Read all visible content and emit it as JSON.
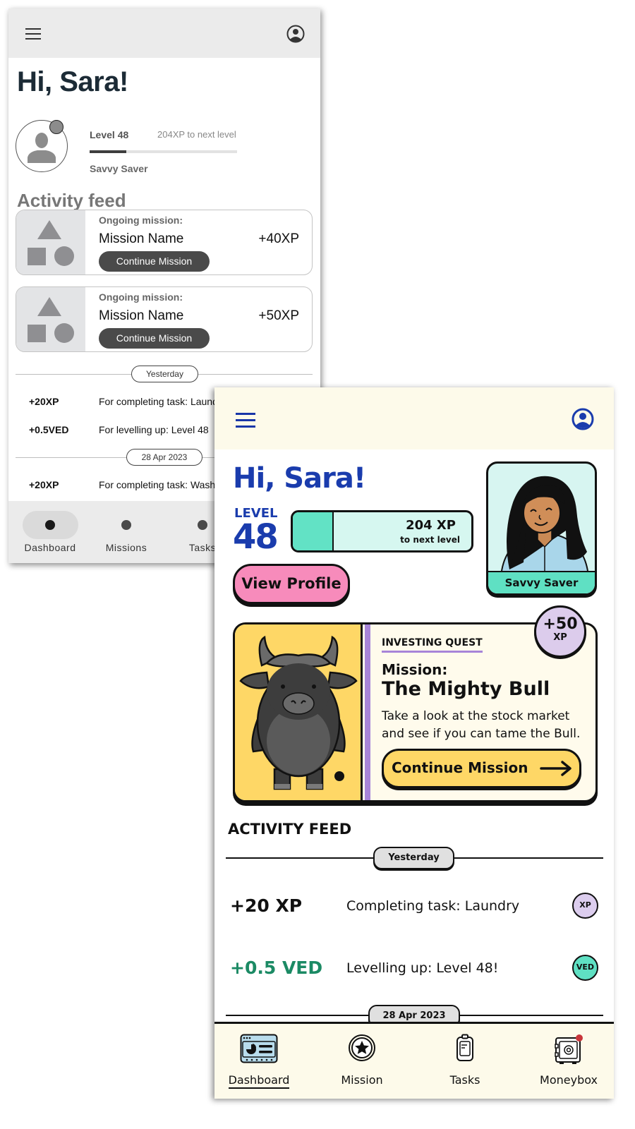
{
  "wireframe": {
    "header": {
      "menu_icon": "hamburger-menu-icon",
      "profile_icon": "user-circle-icon"
    },
    "greeting": "Hi, Sara!",
    "profile": {
      "level_label": "Level 48",
      "to_next_level": "204XP to next level",
      "progress_fraction": 0.25,
      "rank": "Savvy Saver"
    },
    "activity_title": "Activity feed",
    "missions": [
      {
        "subtitle": "Ongoing mission:",
        "name": "Mission Name",
        "xp": "+40XP",
        "button": "Continue Mission"
      },
      {
        "subtitle": "Ongoing mission:",
        "name": "Mission Name",
        "xp": "+50XP",
        "button": "Continue Mission"
      }
    ],
    "feed_groups": [
      {
        "date": "Yesterday",
        "items": [
          {
            "amount": "+20XP",
            "desc": "For completing task: Laundry"
          },
          {
            "amount": "+0.5VED",
            "desc": "For levelling up: Level 48"
          }
        ]
      },
      {
        "date": "28 Apr 2023",
        "items": [
          {
            "amount": "+20XP",
            "desc": "For completing task: Washing"
          }
        ]
      }
    ],
    "nav": [
      {
        "label": "Dashboard",
        "active": true
      },
      {
        "label": "Missions",
        "active": false
      },
      {
        "label": "Tasks",
        "active": false
      }
    ]
  },
  "design": {
    "header": {
      "menu_icon": "hamburger-menu-icon",
      "profile_icon": "user-circle-icon"
    },
    "greeting": "Hi, Sara!",
    "level": {
      "label": "LEVEL",
      "number": "48",
      "xp_to_next": "204 XP",
      "xp_sub": "to next level",
      "progress_fraction": 0.23
    },
    "view_profile_button": "View Profile",
    "avatar": {
      "rank": "Savvy Saver"
    },
    "mission": {
      "quest": "INVESTING QUEST",
      "label": "Mission:",
      "name": "The Mighty Bull",
      "description": "Take a look at the stock market and see if you can tame the Bull.",
      "button": "Continue Mission",
      "reward_amount": "+50",
      "reward_unit": "XP"
    },
    "activity_title": "ACTIVITY FEED",
    "feed_groups": [
      {
        "date": "Yesterday",
        "items": [
          {
            "amount": "+20 XP",
            "desc": "Completing task: Laundry",
            "badge": "XP",
            "amount_color": "#111111",
            "badge_color": "#dccdee"
          },
          {
            "amount": "+0.5 VED",
            "desc": "Levelling up: Level 48!",
            "badge": "VED",
            "amount_color": "#1b8a64",
            "badge_color": "#5fe0c3"
          }
        ]
      },
      {
        "date": "28 Apr 2023",
        "items": []
      }
    ],
    "nav": [
      {
        "label": "Dashboard",
        "icon": "dashboard-icon",
        "active": true
      },
      {
        "label": "Mission",
        "icon": "star-medal-icon",
        "active": false
      },
      {
        "label": "Tasks",
        "icon": "clipboard-icon",
        "active": false
      },
      {
        "label": "Moneybox",
        "icon": "safe-icon",
        "active": false,
        "notification": true
      }
    ],
    "colors": {
      "primary_blue": "#1a3cad",
      "header_bg": "#fdfaea",
      "mint": "#62e2c5",
      "pink": "#f78bbb",
      "yellow": "#fed766",
      "lavender": "#a784d8",
      "ved_green": "#1b8a64",
      "notification_red": "#c8353a"
    }
  }
}
